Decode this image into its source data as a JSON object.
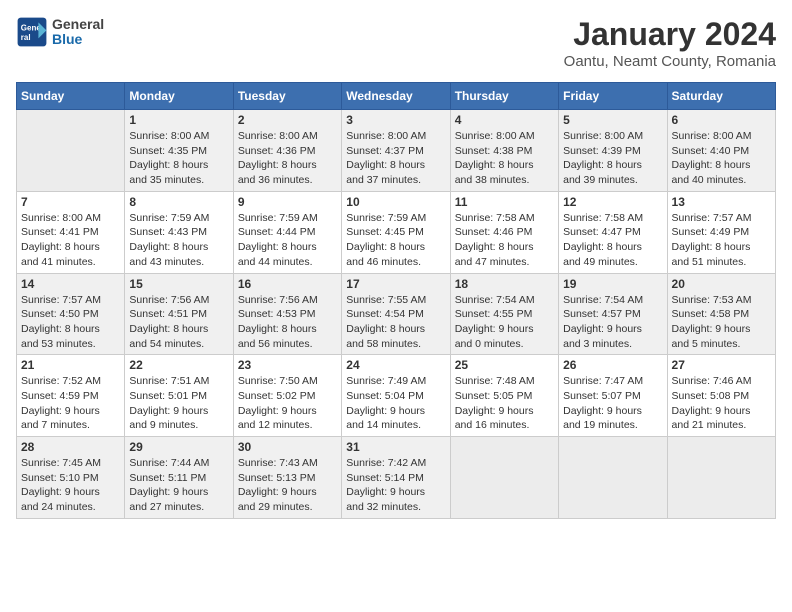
{
  "header": {
    "logo_line1": "General",
    "logo_line2": "Blue",
    "month_title": "January 2024",
    "location": "Oantu, Neamt County, Romania"
  },
  "days_of_week": [
    "Sunday",
    "Monday",
    "Tuesday",
    "Wednesday",
    "Thursday",
    "Friday",
    "Saturday"
  ],
  "weeks": [
    [
      {
        "day": "",
        "sunrise": "",
        "sunset": "",
        "daylight": ""
      },
      {
        "day": "1",
        "sunrise": "Sunrise: 8:00 AM",
        "sunset": "Sunset: 4:35 PM",
        "daylight": "Daylight: 8 hours and 35 minutes."
      },
      {
        "day": "2",
        "sunrise": "Sunrise: 8:00 AM",
        "sunset": "Sunset: 4:36 PM",
        "daylight": "Daylight: 8 hours and 36 minutes."
      },
      {
        "day": "3",
        "sunrise": "Sunrise: 8:00 AM",
        "sunset": "Sunset: 4:37 PM",
        "daylight": "Daylight: 8 hours and 37 minutes."
      },
      {
        "day": "4",
        "sunrise": "Sunrise: 8:00 AM",
        "sunset": "Sunset: 4:38 PM",
        "daylight": "Daylight: 8 hours and 38 minutes."
      },
      {
        "day": "5",
        "sunrise": "Sunrise: 8:00 AM",
        "sunset": "Sunset: 4:39 PM",
        "daylight": "Daylight: 8 hours and 39 minutes."
      },
      {
        "day": "6",
        "sunrise": "Sunrise: 8:00 AM",
        "sunset": "Sunset: 4:40 PM",
        "daylight": "Daylight: 8 hours and 40 minutes."
      }
    ],
    [
      {
        "day": "7",
        "sunrise": "Sunrise: 8:00 AM",
        "sunset": "Sunset: 4:41 PM",
        "daylight": "Daylight: 8 hours and 41 minutes."
      },
      {
        "day": "8",
        "sunrise": "Sunrise: 7:59 AM",
        "sunset": "Sunset: 4:43 PM",
        "daylight": "Daylight: 8 hours and 43 minutes."
      },
      {
        "day": "9",
        "sunrise": "Sunrise: 7:59 AM",
        "sunset": "Sunset: 4:44 PM",
        "daylight": "Daylight: 8 hours and 44 minutes."
      },
      {
        "day": "10",
        "sunrise": "Sunrise: 7:59 AM",
        "sunset": "Sunset: 4:45 PM",
        "daylight": "Daylight: 8 hours and 46 minutes."
      },
      {
        "day": "11",
        "sunrise": "Sunrise: 7:58 AM",
        "sunset": "Sunset: 4:46 PM",
        "daylight": "Daylight: 8 hours and 47 minutes."
      },
      {
        "day": "12",
        "sunrise": "Sunrise: 7:58 AM",
        "sunset": "Sunset: 4:47 PM",
        "daylight": "Daylight: 8 hours and 49 minutes."
      },
      {
        "day": "13",
        "sunrise": "Sunrise: 7:57 AM",
        "sunset": "Sunset: 4:49 PM",
        "daylight": "Daylight: 8 hours and 51 minutes."
      }
    ],
    [
      {
        "day": "14",
        "sunrise": "Sunrise: 7:57 AM",
        "sunset": "Sunset: 4:50 PM",
        "daylight": "Daylight: 8 hours and 53 minutes."
      },
      {
        "day": "15",
        "sunrise": "Sunrise: 7:56 AM",
        "sunset": "Sunset: 4:51 PM",
        "daylight": "Daylight: 8 hours and 54 minutes."
      },
      {
        "day": "16",
        "sunrise": "Sunrise: 7:56 AM",
        "sunset": "Sunset: 4:53 PM",
        "daylight": "Daylight: 8 hours and 56 minutes."
      },
      {
        "day": "17",
        "sunrise": "Sunrise: 7:55 AM",
        "sunset": "Sunset: 4:54 PM",
        "daylight": "Daylight: 8 hours and 58 minutes."
      },
      {
        "day": "18",
        "sunrise": "Sunrise: 7:54 AM",
        "sunset": "Sunset: 4:55 PM",
        "daylight": "Daylight: 9 hours and 0 minutes."
      },
      {
        "day": "19",
        "sunrise": "Sunrise: 7:54 AM",
        "sunset": "Sunset: 4:57 PM",
        "daylight": "Daylight: 9 hours and 3 minutes."
      },
      {
        "day": "20",
        "sunrise": "Sunrise: 7:53 AM",
        "sunset": "Sunset: 4:58 PM",
        "daylight": "Daylight: 9 hours and 5 minutes."
      }
    ],
    [
      {
        "day": "21",
        "sunrise": "Sunrise: 7:52 AM",
        "sunset": "Sunset: 4:59 PM",
        "daylight": "Daylight: 9 hours and 7 minutes."
      },
      {
        "day": "22",
        "sunrise": "Sunrise: 7:51 AM",
        "sunset": "Sunset: 5:01 PM",
        "daylight": "Daylight: 9 hours and 9 minutes."
      },
      {
        "day": "23",
        "sunrise": "Sunrise: 7:50 AM",
        "sunset": "Sunset: 5:02 PM",
        "daylight": "Daylight: 9 hours and 12 minutes."
      },
      {
        "day": "24",
        "sunrise": "Sunrise: 7:49 AM",
        "sunset": "Sunset: 5:04 PM",
        "daylight": "Daylight: 9 hours and 14 minutes."
      },
      {
        "day": "25",
        "sunrise": "Sunrise: 7:48 AM",
        "sunset": "Sunset: 5:05 PM",
        "daylight": "Daylight: 9 hours and 16 minutes."
      },
      {
        "day": "26",
        "sunrise": "Sunrise: 7:47 AM",
        "sunset": "Sunset: 5:07 PM",
        "daylight": "Daylight: 9 hours and 19 minutes."
      },
      {
        "day": "27",
        "sunrise": "Sunrise: 7:46 AM",
        "sunset": "Sunset: 5:08 PM",
        "daylight": "Daylight: 9 hours and 21 minutes."
      }
    ],
    [
      {
        "day": "28",
        "sunrise": "Sunrise: 7:45 AM",
        "sunset": "Sunset: 5:10 PM",
        "daylight": "Daylight: 9 hours and 24 minutes."
      },
      {
        "day": "29",
        "sunrise": "Sunrise: 7:44 AM",
        "sunset": "Sunset: 5:11 PM",
        "daylight": "Daylight: 9 hours and 27 minutes."
      },
      {
        "day": "30",
        "sunrise": "Sunrise: 7:43 AM",
        "sunset": "Sunset: 5:13 PM",
        "daylight": "Daylight: 9 hours and 29 minutes."
      },
      {
        "day": "31",
        "sunrise": "Sunrise: 7:42 AM",
        "sunset": "Sunset: 5:14 PM",
        "daylight": "Daylight: 9 hours and 32 minutes."
      },
      {
        "day": "",
        "sunrise": "",
        "sunset": "",
        "daylight": ""
      },
      {
        "day": "",
        "sunrise": "",
        "sunset": "",
        "daylight": ""
      },
      {
        "day": "",
        "sunrise": "",
        "sunset": "",
        "daylight": ""
      }
    ]
  ]
}
